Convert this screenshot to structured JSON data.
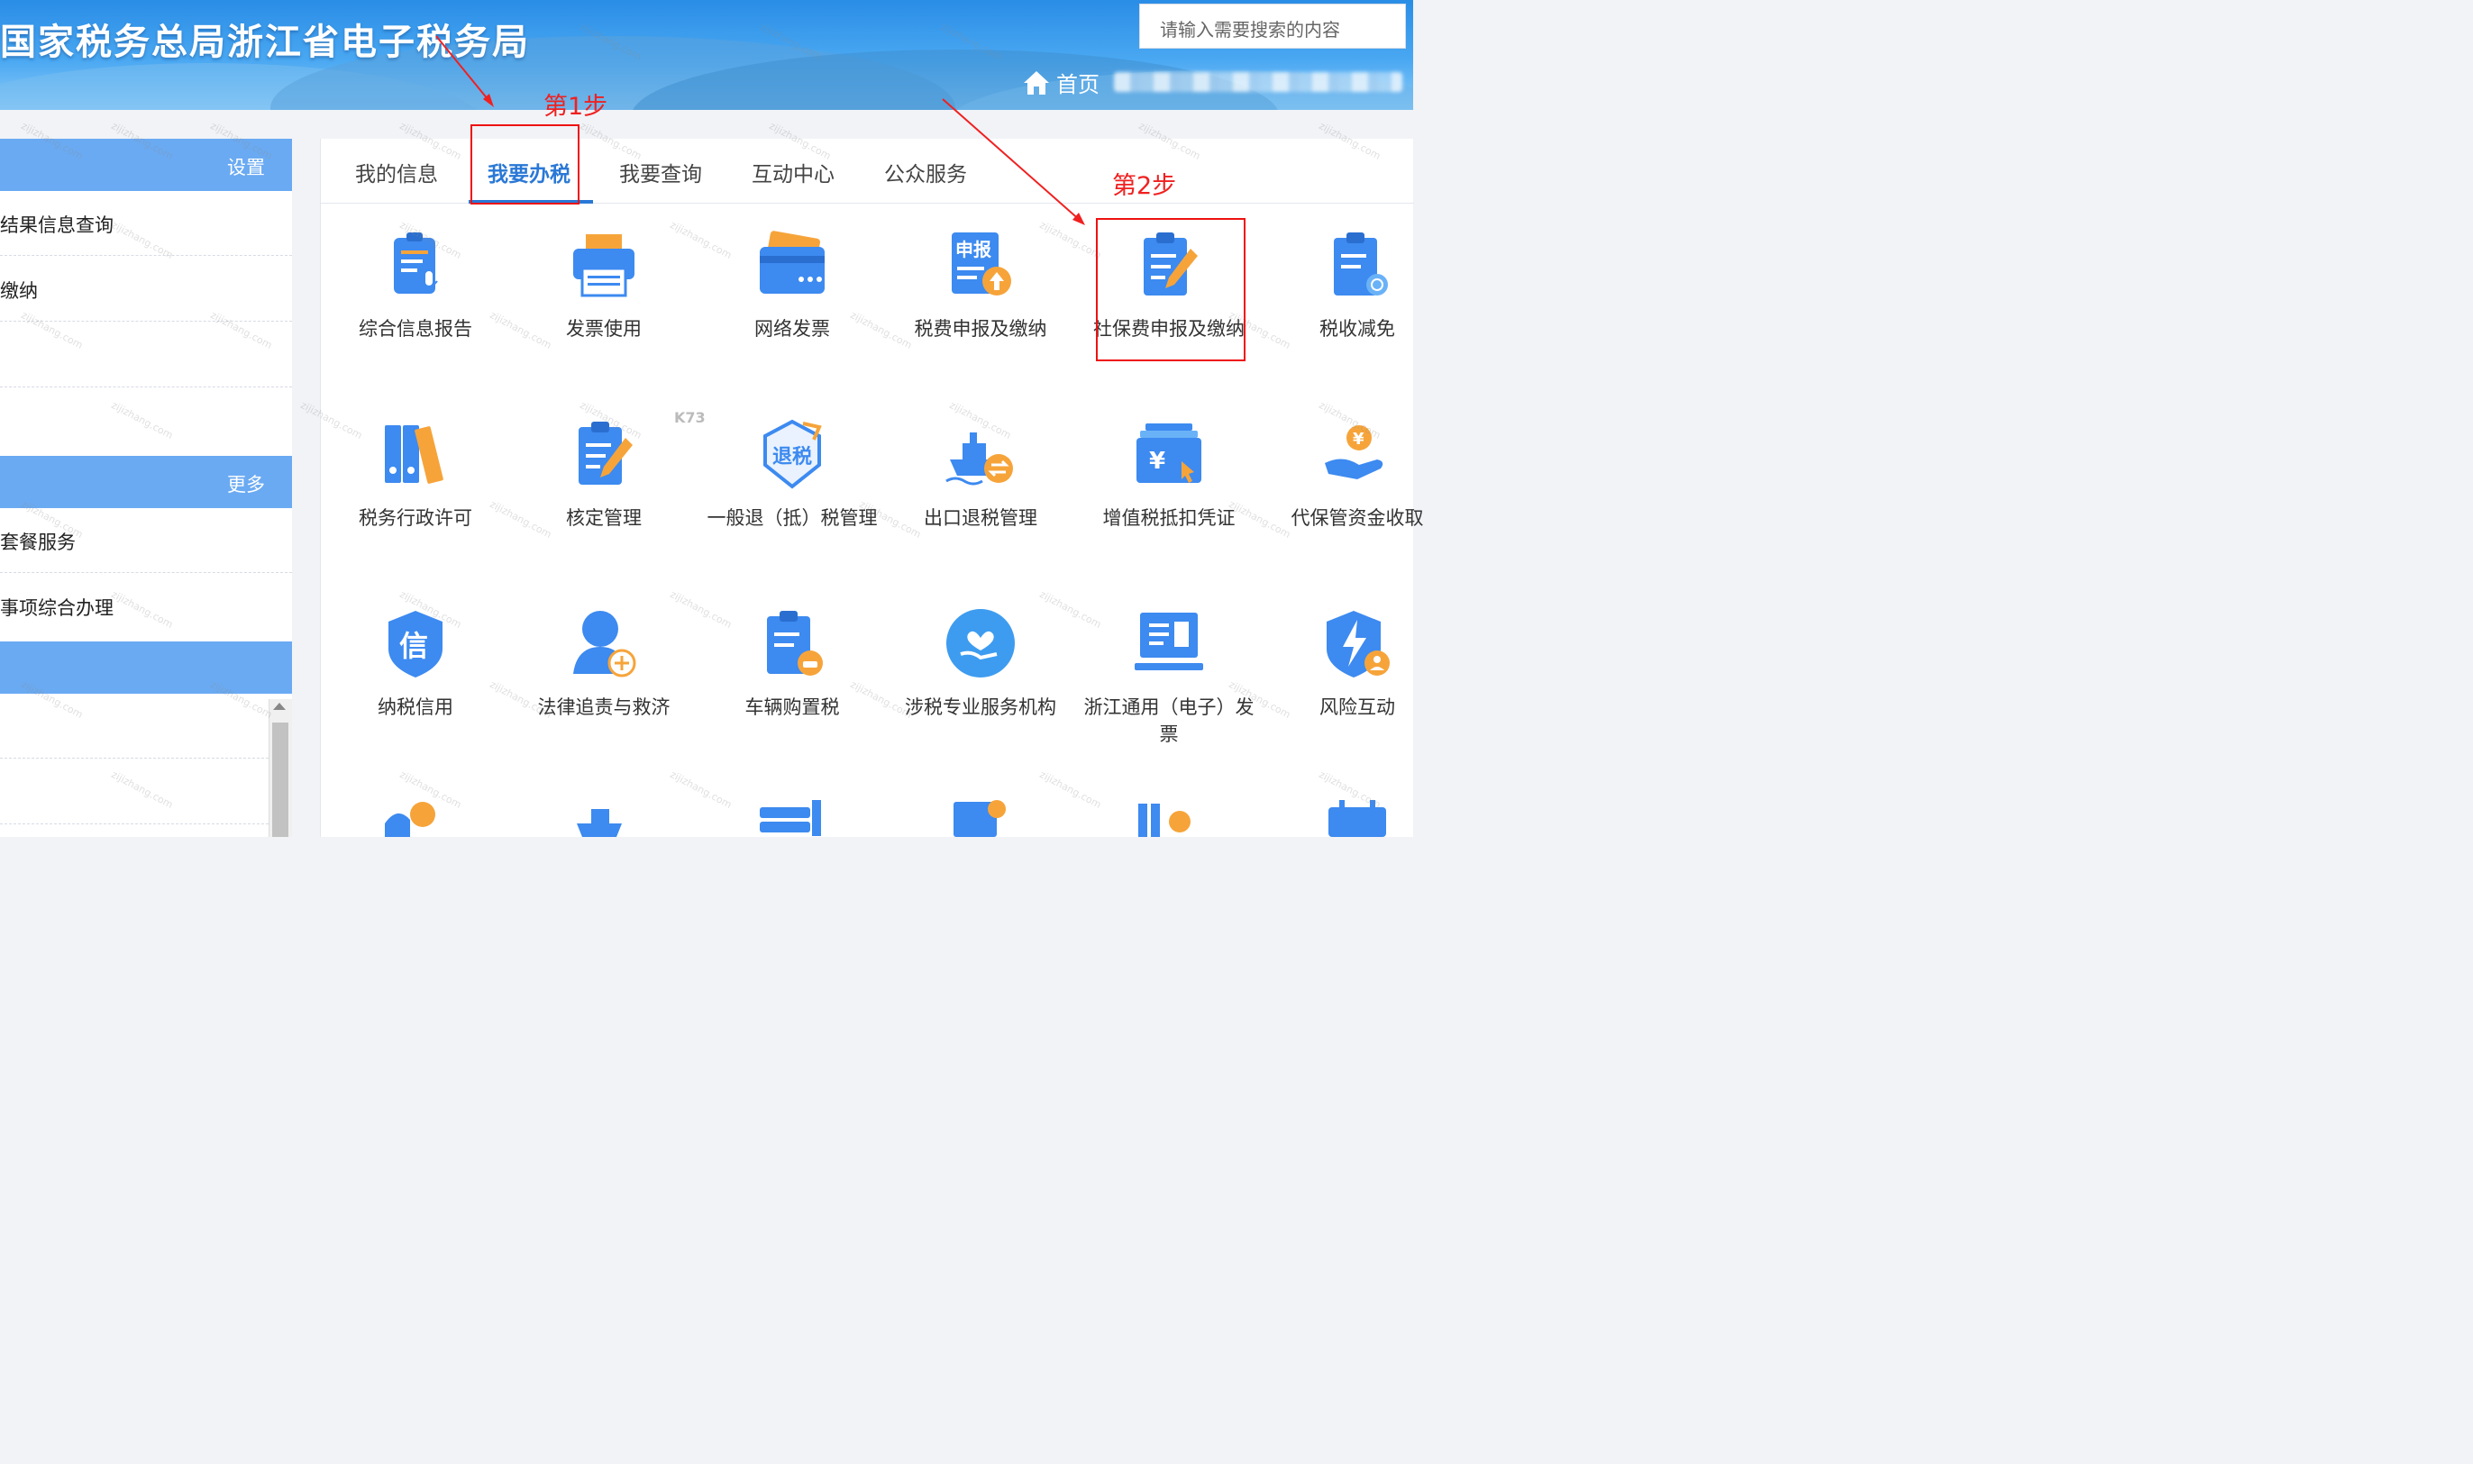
{
  "header": {
    "title": "国家税务总局浙江省电子税务局",
    "search_placeholder": "请输入需要搜索的内容",
    "home_label": "首页"
  },
  "sidebar": {
    "sections": [
      {
        "header": "设置",
        "items": [
          "结果信息查询",
          "缴纳",
          "",
          ""
        ]
      },
      {
        "header": "更多",
        "items": [
          "套餐服务",
          "事项综合办理"
        ]
      },
      {
        "header": "",
        "items": [
          "",
          ""
        ]
      }
    ]
  },
  "tabs": [
    "我的信息",
    "我要办税",
    "我要查询",
    "互动中心",
    "公众服务"
  ],
  "active_tab": "我要办税",
  "tiles": [
    {
      "label": "综合信息报告",
      "icon": "clipboard-mic-icon"
    },
    {
      "label": "发票使用",
      "icon": "printer-icon"
    },
    {
      "label": "网络发票",
      "icon": "card-icon"
    },
    {
      "label": "税费申报及缴纳",
      "icon": "declare-upload-icon"
    },
    {
      "label": "社保费申报及缴纳",
      "icon": "clipboard-pen-icon"
    },
    {
      "label": "税收减免",
      "icon": "clipboard-power-icon"
    },
    {
      "label": "税务行政许可",
      "icon": "binders-icon"
    },
    {
      "label": "核定管理",
      "icon": "clipboard-pen-icon"
    },
    {
      "label": "一般退（抵）税管理",
      "icon": "refund-shield-icon"
    },
    {
      "label": "出口退税管理",
      "icon": "ship-exchange-icon"
    },
    {
      "label": "增值税抵扣凭证",
      "icon": "yuan-card-icon"
    },
    {
      "label": "代保管资金收取",
      "icon": "hand-coin-icon"
    },
    {
      "label": "纳税信用",
      "icon": "credit-shield-icon"
    },
    {
      "label": "法律追责与救济",
      "icon": "judge-scale-icon"
    },
    {
      "label": "车辆购置税",
      "icon": "clipboard-car-icon"
    },
    {
      "label": "涉税专业服务机构",
      "icon": "heart-hand-icon"
    },
    {
      "label": "浙江通用（电子）发票",
      "icon": "monitor-invoice-icon"
    },
    {
      "label": "风险互动",
      "icon": "bolt-shield-icon"
    }
  ],
  "annotations": {
    "step1": "第1步",
    "step2": "第2步"
  },
  "colors": {
    "banner": "#2a8de6",
    "accent": "#2a78d6",
    "sidebar_header": "#6aaaf2",
    "icon_blue": "#3d8af0",
    "icon_orange": "#f6a43a",
    "annotation": "#f02020"
  }
}
